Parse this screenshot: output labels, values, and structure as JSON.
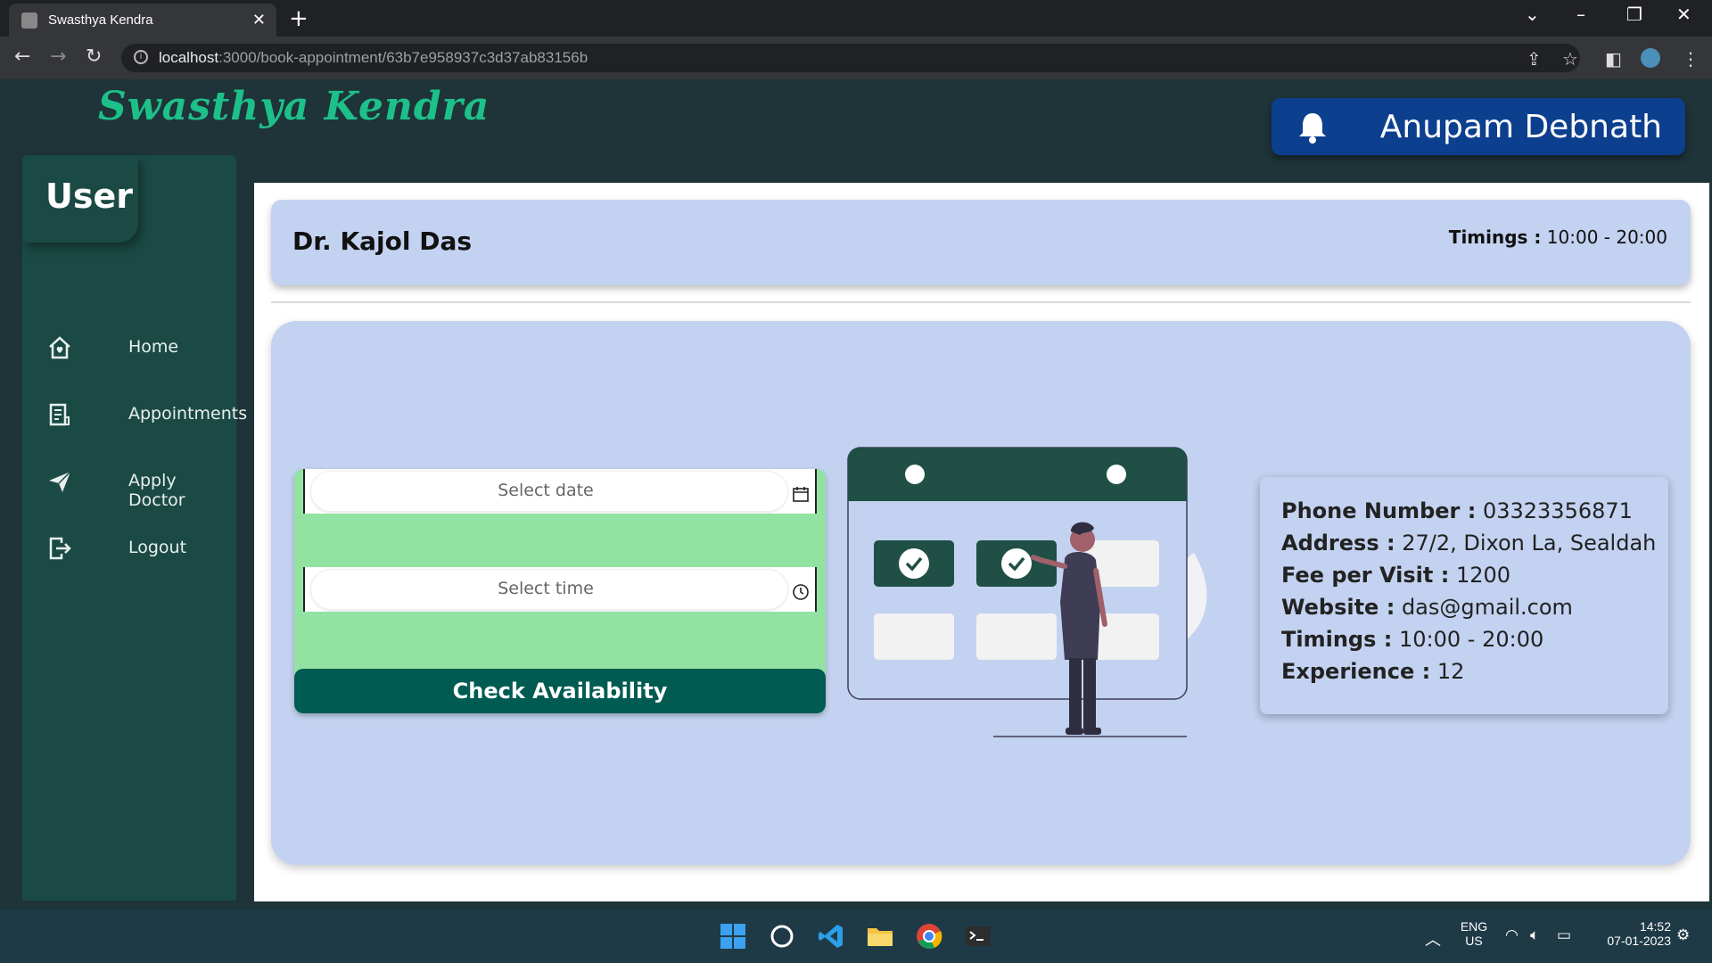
{
  "browser": {
    "tab_title": "Swasthya Kendra",
    "url_host": "localhost",
    "url_rest": ":3000/book-appointment/63b7e958937c3d37ab83156b"
  },
  "app": {
    "brand": "Swasthya Kendra",
    "user_name": "Anupam Debnath",
    "accent_color": "#1ec08a"
  },
  "sidebar": {
    "title": "User",
    "items": [
      {
        "label": "Home",
        "icon": "home-icon"
      },
      {
        "label": "Appointments",
        "icon": "list-icon"
      },
      {
        "label": "Apply Doctor",
        "icon": "send-icon"
      },
      {
        "label": "Logout",
        "icon": "logout-icon"
      }
    ]
  },
  "doctor": {
    "name": "Dr. Kajol Das",
    "timings_label": "Timings :",
    "timings_value": "10:00 - 20:00"
  },
  "form": {
    "date_placeholder": "Select date",
    "time_placeholder": "Select time",
    "check_button": "Check Availability"
  },
  "info": {
    "phone_label": "Phone Number :",
    "phone": "03323356871",
    "address_label": "Address :",
    "address": "27/2, Dixon La, Sealdah",
    "fee_label": "Fee per Visit :",
    "fee": "1200",
    "website_label": "Website :",
    "website": "das@gmail.com",
    "timings_label": "Timings :",
    "timings": "10:00 - 20:00",
    "experience_label": "Experience :",
    "experience": "12"
  },
  "taskbar": {
    "lang_top": "ENG",
    "lang_bottom": "US",
    "time": "14:52",
    "date": "07-01-2023"
  }
}
